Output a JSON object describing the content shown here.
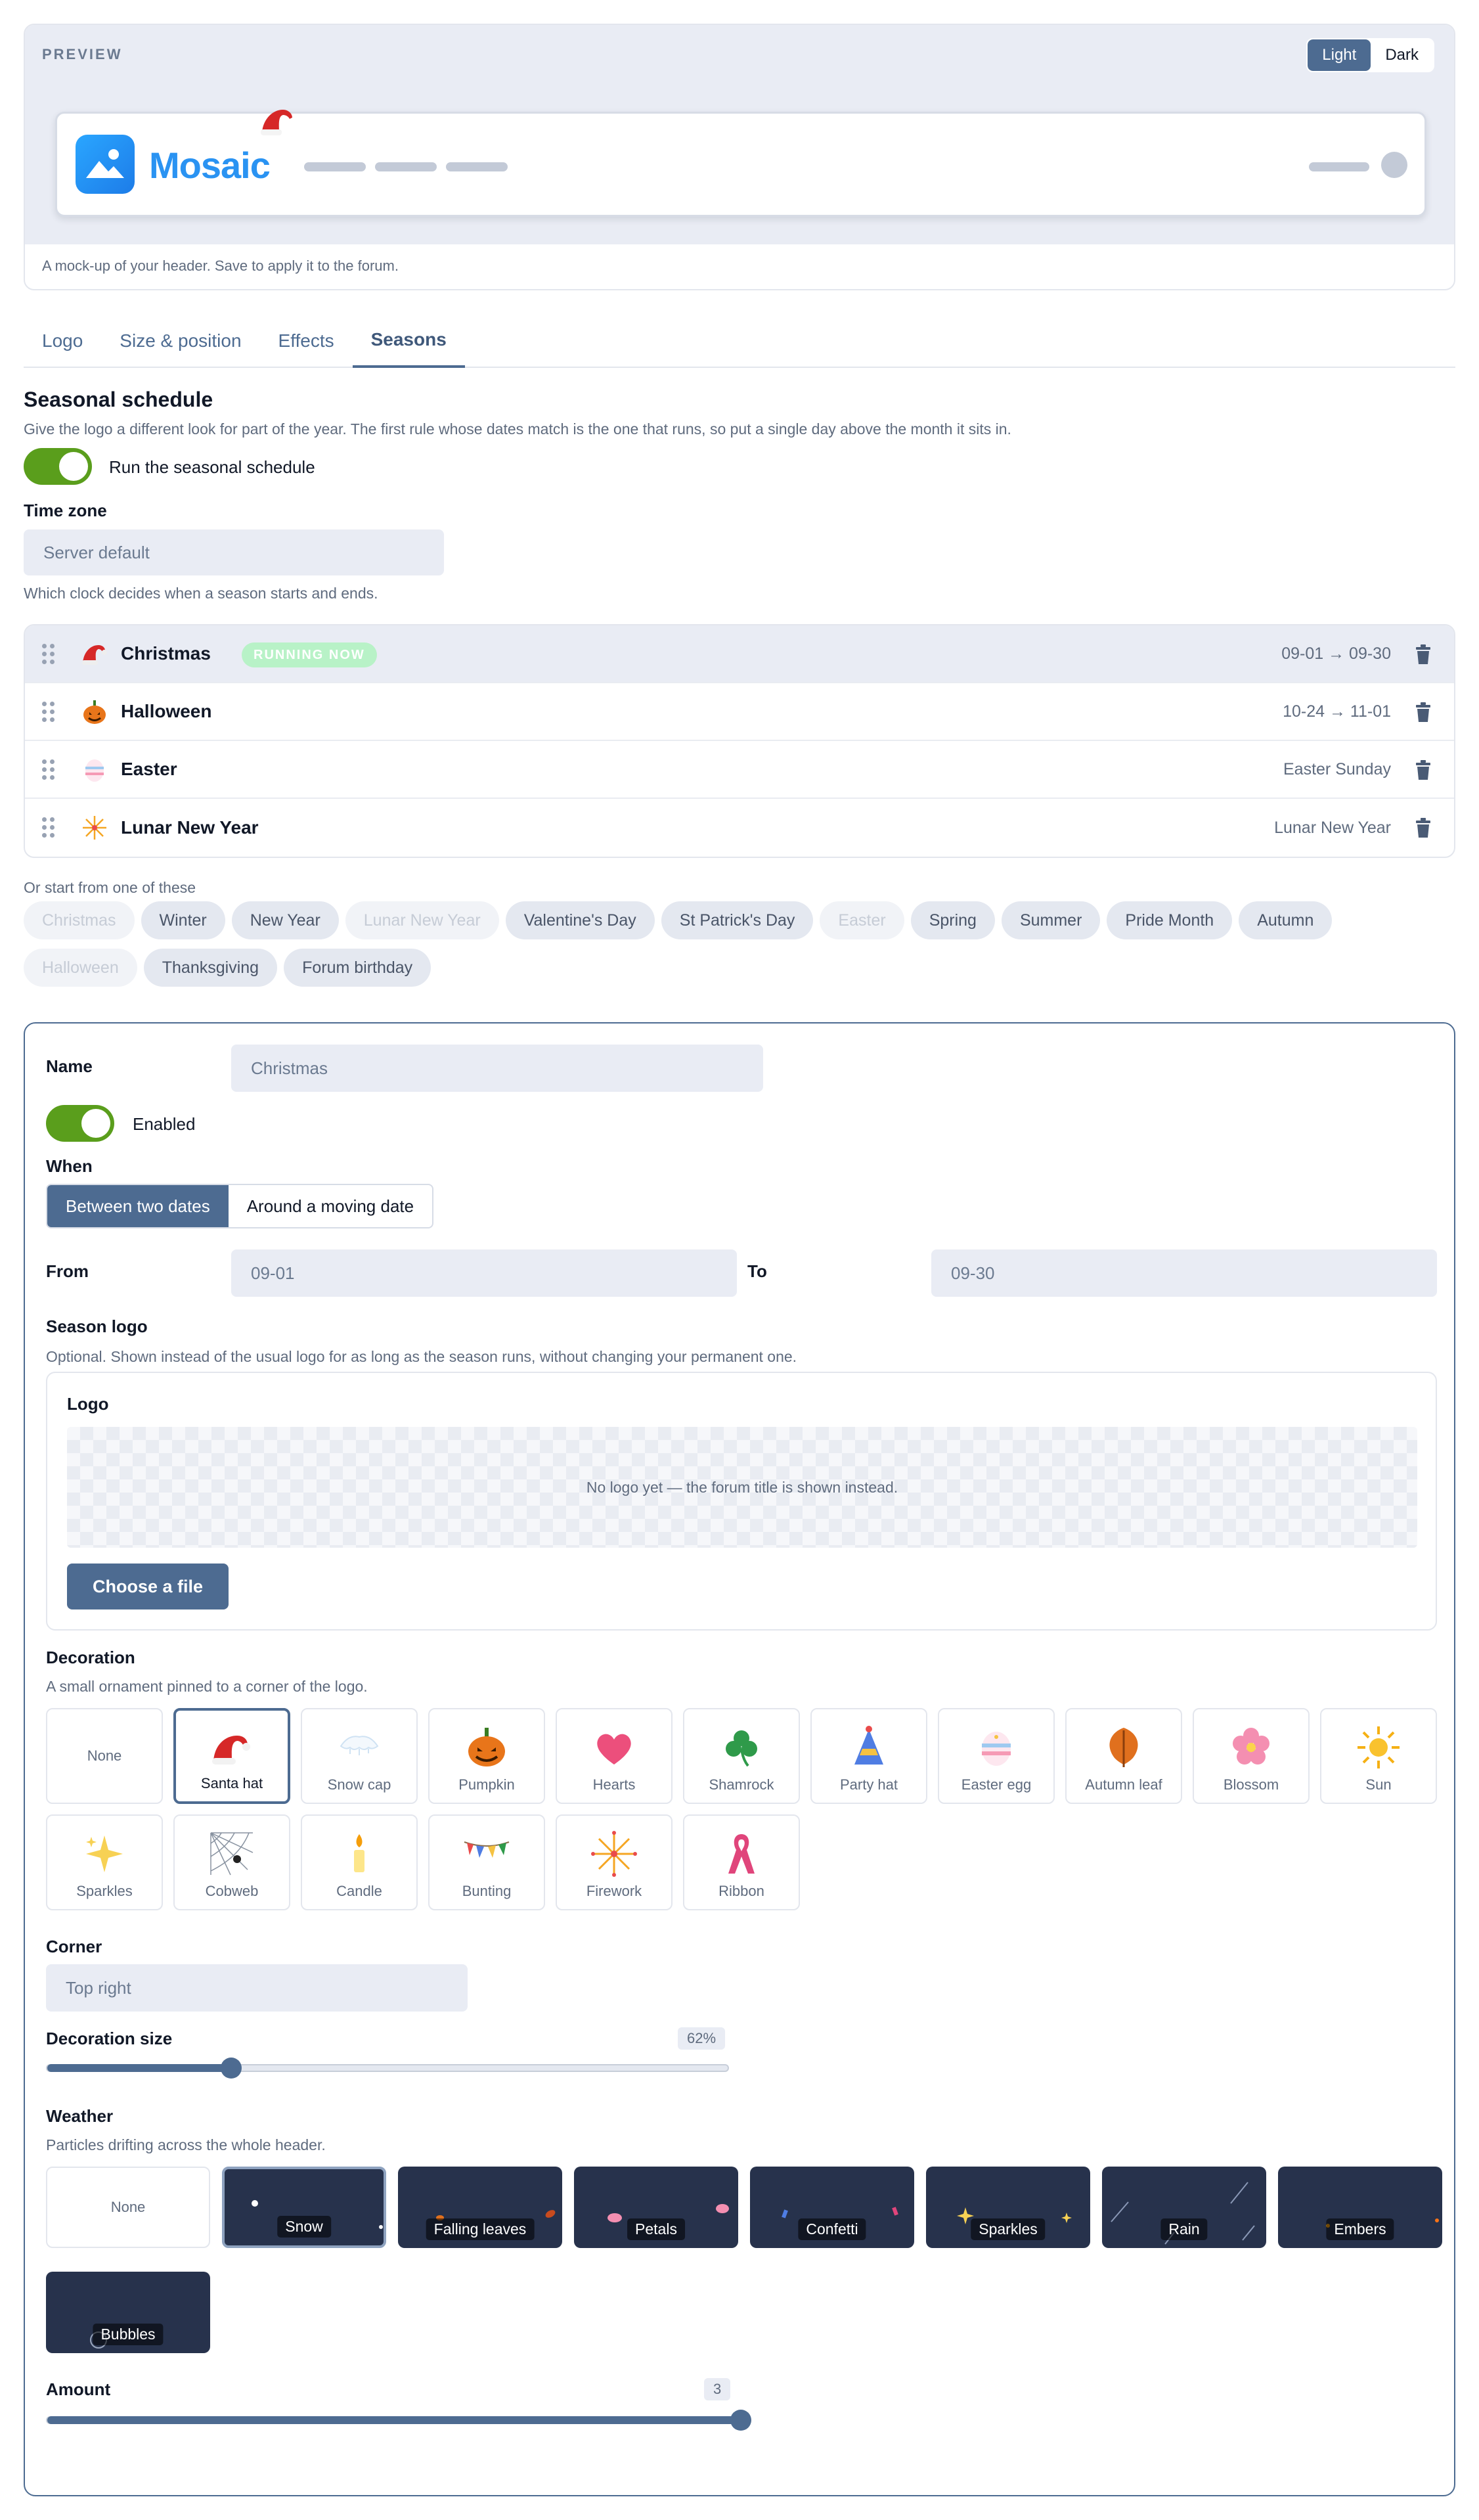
{
  "preview": {
    "label": "PREVIEW",
    "mode_light": "Light",
    "mode_dark": "Dark",
    "site_title": "Mosaic",
    "note": "A mock-up of your header. Save to apply it to the forum."
  },
  "tabs": [
    {
      "label": "Logo"
    },
    {
      "label": "Size & position"
    },
    {
      "label": "Effects"
    },
    {
      "label": "Seasons"
    }
  ],
  "schedule": {
    "title": "Seasonal schedule",
    "description": "Give the logo a different look for part of the year. The first rule whose dates match is the one that runs, so put a single day above the month it sits in.",
    "toggle_label": "Run the seasonal schedule",
    "timezone_label": "Time zone",
    "timezone_value": "Server default",
    "timezone_hint": "Which clock decides when a season starts and ends.",
    "running_badge": "RUNNING NOW",
    "rules": [
      {
        "name": "Christmas",
        "range": "09-01 → 09-30",
        "icon": "santa-hat-icon"
      },
      {
        "name": "Halloween",
        "range": "10-24 → 11-01",
        "icon": "pumpkin-icon"
      },
      {
        "name": "Easter",
        "range": "Easter Sunday",
        "icon": "easter-egg-icon"
      },
      {
        "name": "Lunar New Year",
        "range": "Lunar New Year",
        "icon": "firework-icon"
      }
    ],
    "presets_label": "Or start from one of these",
    "presets": [
      {
        "label": "Christmas",
        "used": true
      },
      {
        "label": "Winter",
        "used": false
      },
      {
        "label": "New Year",
        "used": false
      },
      {
        "label": "Lunar New Year",
        "used": true
      },
      {
        "label": "Valentine's Day",
        "used": false
      },
      {
        "label": "St Patrick's Day",
        "used": false
      },
      {
        "label": "Easter",
        "used": true
      },
      {
        "label": "Spring",
        "used": false
      },
      {
        "label": "Summer",
        "used": false
      },
      {
        "label": "Pride Month",
        "used": false
      },
      {
        "label": "Autumn",
        "used": false
      },
      {
        "label": "Halloween",
        "used": true
      },
      {
        "label": "Thanksgiving",
        "used": false
      },
      {
        "label": "Forum birthday",
        "used": false
      }
    ]
  },
  "editor": {
    "name_label": "Name",
    "name_value": "Christmas",
    "enabled_label": "Enabled",
    "when_label": "When",
    "when_option_dates": "Between two dates",
    "when_option_moving": "Around a moving date",
    "from_label": "From",
    "from_value": "09-01",
    "to_label": "To",
    "to_value": "09-30",
    "season_logo_title": "Season logo",
    "season_logo_hint": "Optional. Shown instead of the usual logo for as long as the season runs, without changing your permanent one.",
    "logo_label": "Logo",
    "logo_empty": "No logo yet — the forum title is shown instead.",
    "choose_file": "Choose a file",
    "decoration_title": "Decoration",
    "decoration_hint": "A small ornament pinned to a corner of the logo.",
    "decorations": [
      {
        "label": "None",
        "icon": "none"
      },
      {
        "label": "Santa hat",
        "icon": "santa-hat-icon",
        "selected": true
      },
      {
        "label": "Snow cap",
        "icon": "snow-cap-icon"
      },
      {
        "label": "Pumpkin",
        "icon": "pumpkin-icon"
      },
      {
        "label": "Hearts",
        "icon": "heart-icon"
      },
      {
        "label": "Shamrock",
        "icon": "shamrock-icon"
      },
      {
        "label": "Party hat",
        "icon": "party-hat-icon"
      },
      {
        "label": "Easter egg",
        "icon": "easter-egg-icon"
      },
      {
        "label": "Autumn leaf",
        "icon": "autumn-leaf-icon"
      },
      {
        "label": "Blossom",
        "icon": "blossom-icon"
      },
      {
        "label": "Sun",
        "icon": "sun-icon"
      },
      {
        "label": "Sparkles",
        "icon": "sparkles-icon"
      },
      {
        "label": "Cobweb",
        "icon": "cobweb-icon"
      },
      {
        "label": "Candle",
        "icon": "candle-icon"
      },
      {
        "label": "Bunting",
        "icon": "bunting-icon"
      },
      {
        "label": "Firework",
        "icon": "firework-icon"
      },
      {
        "label": "Ribbon",
        "icon": "ribbon-icon"
      }
    ],
    "corner_label": "Corner",
    "corner_value": "Top right",
    "deco_size_label": "Decoration size",
    "deco_size_value": "62%",
    "deco_size_fraction": 0.27,
    "weather_title": "Weather",
    "weather_hint": "Particles drifting across the whole header.",
    "weather": [
      {
        "label": "None"
      },
      {
        "label": "Snow",
        "selected": true
      },
      {
        "label": "Falling leaves"
      },
      {
        "label": "Petals"
      },
      {
        "label": "Confetti"
      },
      {
        "label": "Sparkles"
      },
      {
        "label": "Rain"
      },
      {
        "label": "Embers"
      },
      {
        "label": "Bubbles"
      }
    ],
    "amount_label": "Amount",
    "amount_value": "3",
    "amount_fraction": 1.0
  },
  "colors": {
    "accent": "#4d6b91",
    "toggle_on": "#5a9e1c",
    "badge_running": "#b8f2c7",
    "weather_tile": "#27324c"
  }
}
